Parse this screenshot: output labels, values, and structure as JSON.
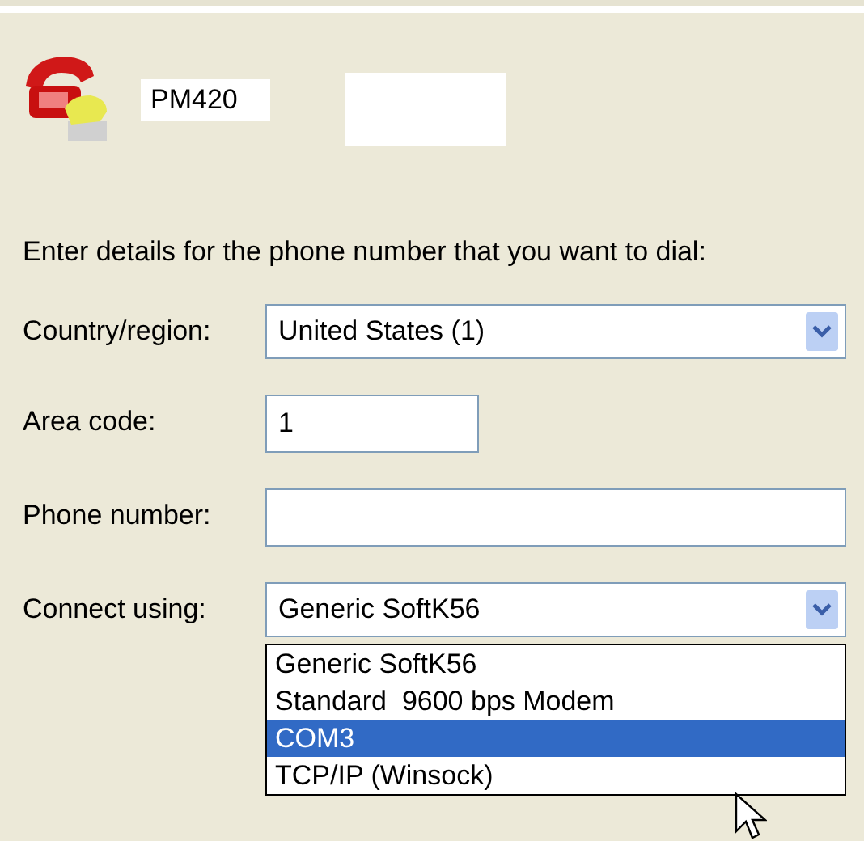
{
  "connection": {
    "name": "PM420"
  },
  "instruction": "Enter details for the phone number that you want to dial:",
  "fields": [
    {
      "kind": "combo",
      "label": "Country/region:",
      "value": "United States (1)"
    },
    {
      "kind": "short",
      "label": "Area code:",
      "value": "1"
    },
    {
      "kind": "text",
      "label": "Phone number:"
    },
    {
      "kind": "combo",
      "label": "Connect using:",
      "value": "Generic SoftK56",
      "expanded": true
    }
  ],
  "dropdown_options": [
    {
      "label": "Generic SoftK56",
      "selected": false
    },
    {
      "label": "Standard  9600 bps Modem",
      "selected": false
    },
    {
      "label": "COM3",
      "selected": true
    },
    {
      "label": "TCP/IP (Winsock)",
      "selected": false
    }
  ]
}
